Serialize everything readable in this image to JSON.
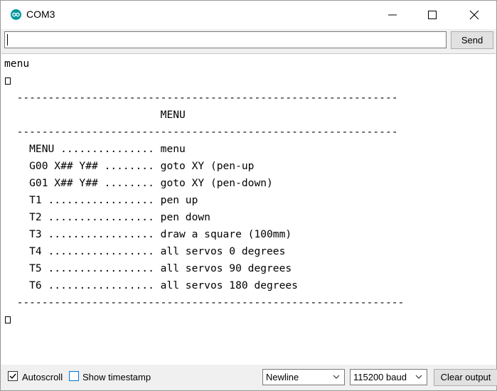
{
  "window": {
    "title": "COM3"
  },
  "send_bar": {
    "input_value": "",
    "send_label": "Send"
  },
  "output_lines": [
    "menu",
    "",
    "  -------------------------------------------------------------",
    "                         MENU",
    "  -------------------------------------------------------------",
    "    MENU ............... menu",
    "    G00 X## Y## ........ goto XY (pen-up",
    "    G01 X## Y## ........ goto XY (pen-down)",
    "    T1 ................. pen up",
    "    T2 ................. pen down",
    "    T3 ................. draw a square (100mm)",
    "    T4 ................. all servos 0 degrees",
    "    T5 ................. all servos 90 degrees",
    "    T6 ................. all servos 180 degrees",
    "  --------------------------------------------------------------",
    ""
  ],
  "status_bar": {
    "autoscroll_label": "Autoscroll",
    "autoscroll_checked": true,
    "timestamp_label": "Show timestamp",
    "timestamp_checked": false,
    "line_ending": "Newline",
    "baud_rate": "115200 baud",
    "clear_label": "Clear output"
  },
  "colors": {
    "arduino_teal": "#00979c",
    "focus_blue": "#0078d7"
  }
}
